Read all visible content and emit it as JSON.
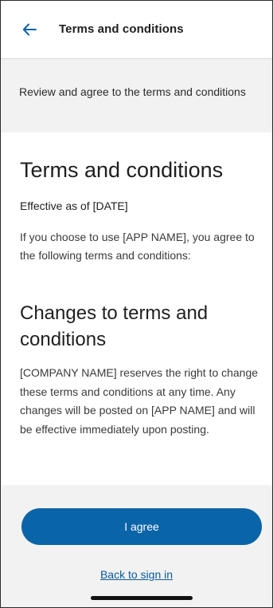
{
  "header": {
    "back_icon": "arrow-left-icon",
    "title": "Terms and conditions"
  },
  "intro": {
    "text": "Review and agree to the terms and conditions"
  },
  "content": {
    "heading": "Terms and conditions",
    "effective": "Effective as of [DATE]",
    "paragraph1": "If you choose to use [APP NAME], you agree to the following terms and conditions:",
    "subheading": "Changes to terms and conditions",
    "paragraph2": "[COMPANY NAME] reserves the right to change these terms and conditions at any time. Any changes will be posted on [APP NAME] and will be effective immediately upon posting."
  },
  "footer": {
    "agree_label": "I agree",
    "back_link_label": "Back to sign in"
  },
  "colors": {
    "accent": "#0a64a8",
    "link": "#0a5a9c",
    "band_background": "#f2f2f2"
  }
}
